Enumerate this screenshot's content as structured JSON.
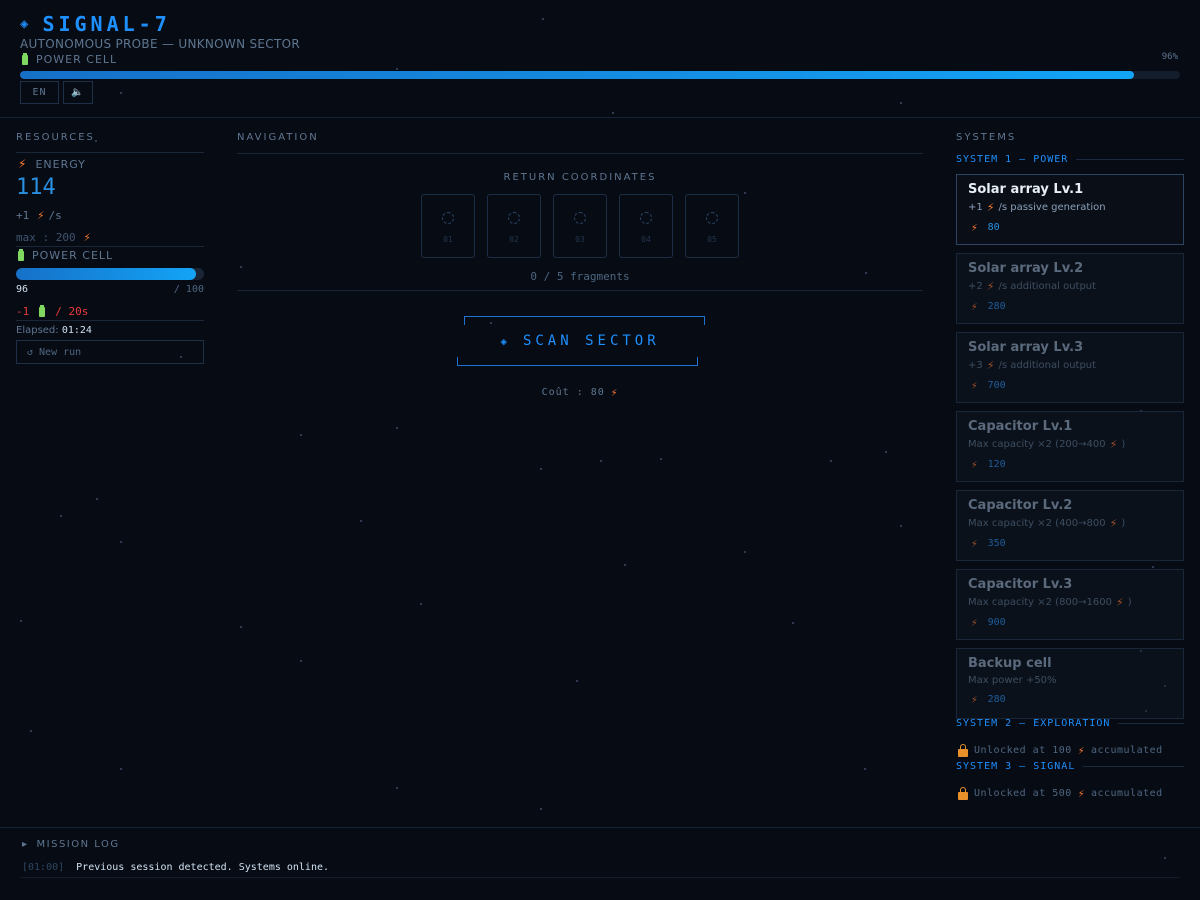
{
  "header": {
    "title": "SIGNAL-7",
    "subtitle": "AUTONOMOUS PROBE — UNKNOWN SECTOR",
    "power_label": "POWER CELL",
    "power_pct_label": "96%",
    "power_fraction": 0.96,
    "lang_label": "EN",
    "sound_label": "🔈"
  },
  "resources": {
    "title": "RESOURCES",
    "energy_label": "ENERGY",
    "energy_value": "114",
    "rate_prefix": "+1",
    "rate_suffix": "/s",
    "max_label": "max : 200",
    "power_label": "POWER CELL",
    "power_value": "96",
    "power_max": "/ 100",
    "power_fraction": 0.96,
    "drain_prefix": "-1",
    "drain_suffix": "/ 20s",
    "elapsed_label": "Elapsed:",
    "elapsed_value": "01:24",
    "new_run_label": "↺ New run"
  },
  "navigation": {
    "title": "NAVIGATION",
    "return_title": "RETURN COORDINATES",
    "fragments": [
      "01",
      "02",
      "03",
      "04",
      "05"
    ],
    "fragment_count": "0 / 5 fragments",
    "scan_label": "SCAN SECTOR",
    "cost_label": "Coût : 80"
  },
  "systems": {
    "title": "SYSTEMS",
    "system1_title": "SYSTEM 1 — POWER",
    "upgrades": [
      {
        "name": "Solar array Lv.1",
        "desc_prefix": "+1",
        "desc_suffix": "/s passive generation",
        "cost": "80",
        "active": true
      },
      {
        "name": "Solar array Lv.2",
        "desc_prefix": "+2",
        "desc_suffix": "/s additional output",
        "cost": "280",
        "active": false
      },
      {
        "name": "Solar array Lv.3",
        "desc_prefix": "+3",
        "desc_suffix": "/s additional output",
        "cost": "700",
        "active": false
      },
      {
        "name": "Capacitor Lv.1",
        "desc_prefix": "Max capacity ×2 (200→400",
        "desc_suffix": ")",
        "cost": "120",
        "active": false
      },
      {
        "name": "Capacitor Lv.2",
        "desc_prefix": "Max capacity ×2 (400→800",
        "desc_suffix": ")",
        "cost": "350",
        "active": false
      },
      {
        "name": "Capacitor Lv.3",
        "desc_prefix": "Max capacity ×2 (800→1600",
        "desc_suffix": ")",
        "cost": "900",
        "active": false
      },
      {
        "name": "Backup cell",
        "desc_prefix": "Max power +50%",
        "desc_suffix": "",
        "cost": "280",
        "active": false
      }
    ],
    "system2_title": "SYSTEM 2 — EXPLORATION",
    "system2_lock_prefix": "Unlocked at 100",
    "system2_lock_suffix": "accumulated",
    "system3_title": "SYSTEM 3 — SIGNAL",
    "system3_lock_prefix": "Unlocked at 500",
    "system3_lock_suffix": "accumulated"
  },
  "log": {
    "title": "MISSION LOG",
    "entries": [
      {
        "time": "[01:00]",
        "text": "Previous session detected. Systems online."
      }
    ]
  },
  "colors": {
    "accent": "#1e90ff",
    "energy": "#ff7a2e",
    "danger": "#e83a3a",
    "battery": "#7fd860",
    "lock": "#e8912a"
  }
}
